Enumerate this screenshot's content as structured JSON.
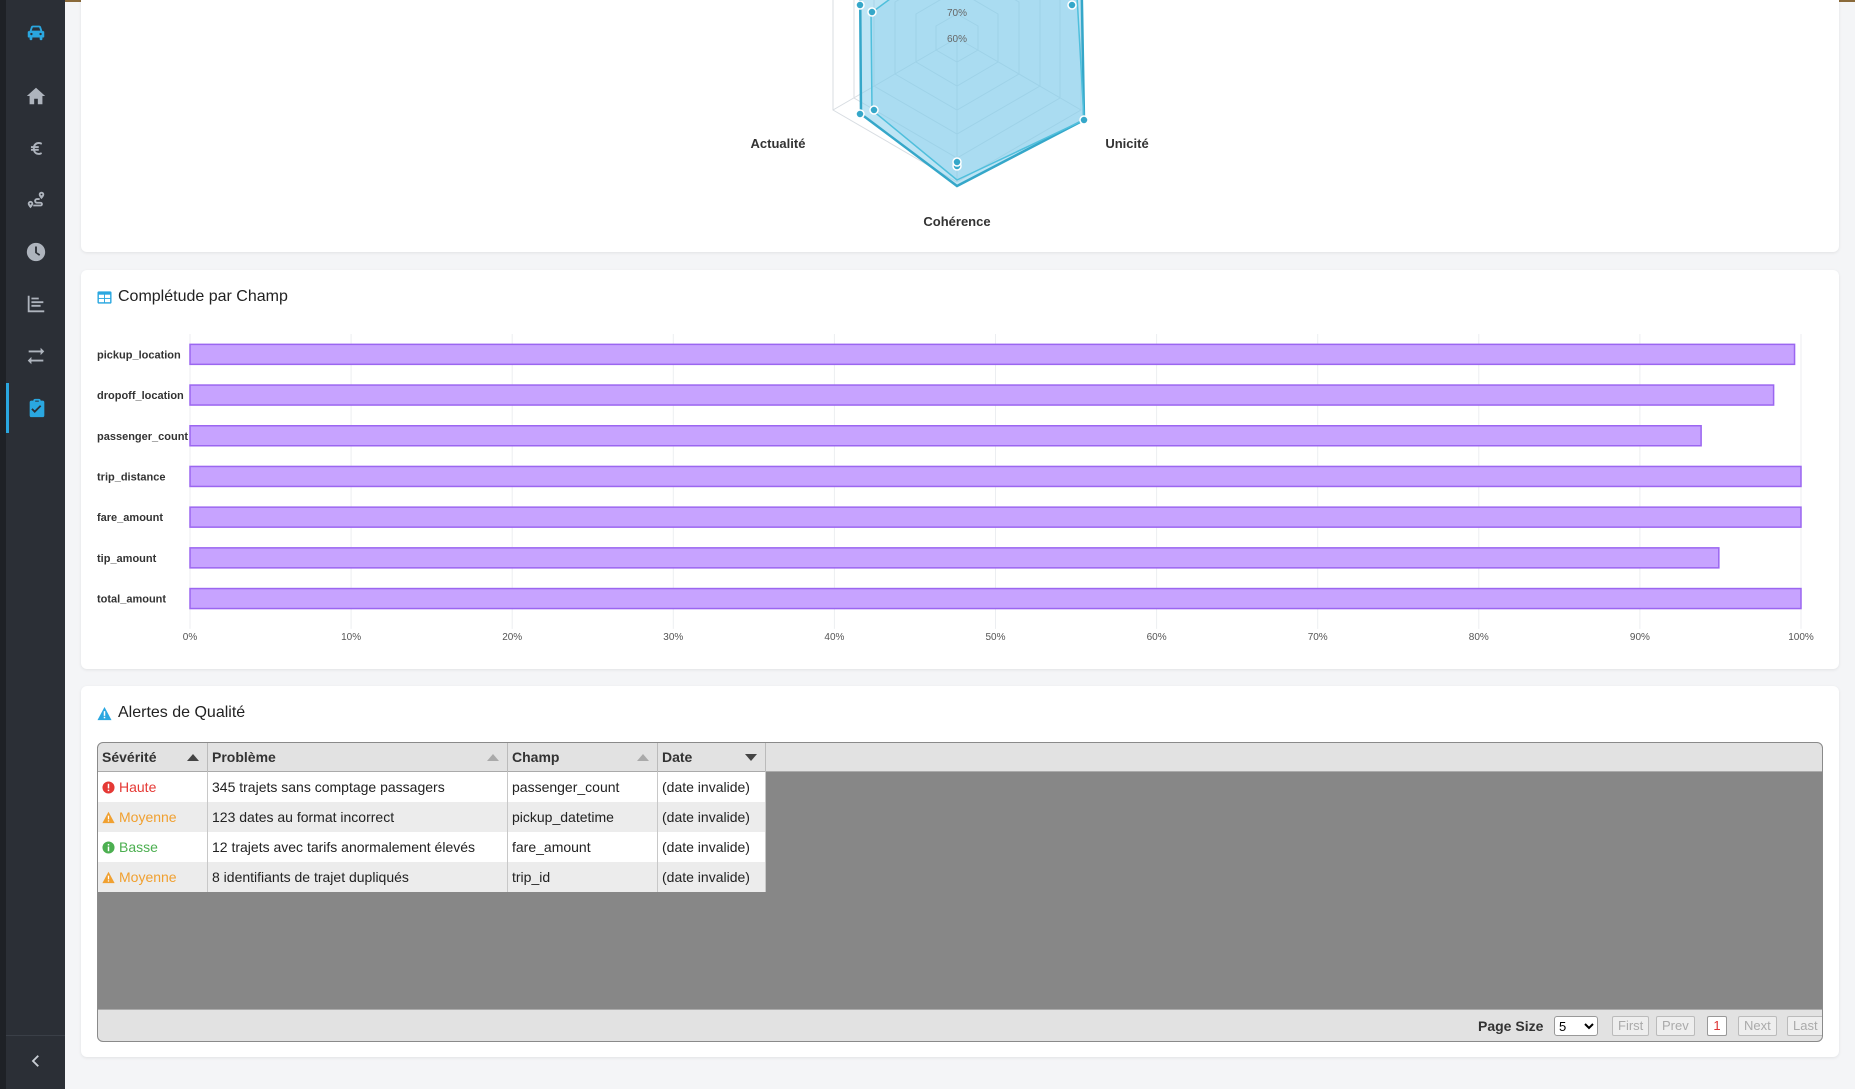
{
  "sidebar": {
    "items": [
      {
        "icon": "taxi-icon"
      },
      {
        "icon": "home-icon"
      },
      {
        "icon": "euro-icon"
      },
      {
        "icon": "route-icon"
      },
      {
        "icon": "clock-icon"
      },
      {
        "icon": "bar-chart-icon"
      },
      {
        "icon": "exchange-icon"
      },
      {
        "icon": "clipboard-check-icon"
      }
    ],
    "active_index": 7,
    "accent": "#2aa7e0"
  },
  "radar": {
    "axes": [
      "Actualité",
      "Unicité",
      "Cohérence"
    ],
    "tick_labels": [
      "70%",
      "60%"
    ]
  },
  "completeness": {
    "title": "Complétude par Champ",
    "chart_data": {
      "type": "bar",
      "orientation": "horizontal",
      "categories": [
        "pickup_location",
        "dropoff_location",
        "passenger_count",
        "trip_distance",
        "fare_amount",
        "tip_amount",
        "total_amount"
      ],
      "values": [
        99.6,
        98.3,
        93.8,
        100,
        100,
        94.9,
        100
      ],
      "xlim": [
        0,
        100
      ],
      "xticks": [
        "0%",
        "10%",
        "20%",
        "30%",
        "40%",
        "50%",
        "60%",
        "70%",
        "80%",
        "90%",
        "100%"
      ],
      "bar_color": "#c7a3ff",
      "bar_border": "#9b66f0",
      "grid": true
    }
  },
  "alerts": {
    "title": "Alertes de Qualité",
    "columns": [
      "Sévérité",
      "Problème",
      "Champ",
      "Date"
    ],
    "rows": [
      {
        "severity": "Haute",
        "level": "high",
        "problem": "345 trajets sans comptage passagers",
        "field": "passenger_count",
        "date": "(date invalide)"
      },
      {
        "severity": "Moyenne",
        "level": "medium",
        "problem": "123 dates au format incorrect",
        "field": "pickup_datetime",
        "date": "(date invalide)"
      },
      {
        "severity": "Basse",
        "level": "low",
        "problem": "12 trajets avec tarifs anormalement élevés",
        "field": "fare_amount",
        "date": "(date invalide)"
      },
      {
        "severity": "Moyenne",
        "level": "medium",
        "problem": "8 identifiants de trajet dupliqués",
        "field": "trip_id",
        "date": "(date invalide)"
      }
    ],
    "severity_colors": {
      "high": "#e53935",
      "medium": "#f0a030",
      "low": "#4caf50"
    },
    "pagination": {
      "page_size_label": "Page Size",
      "page_size": "5",
      "first": "First",
      "prev": "Prev",
      "current": "1",
      "next": "Next",
      "last": "Last"
    }
  }
}
